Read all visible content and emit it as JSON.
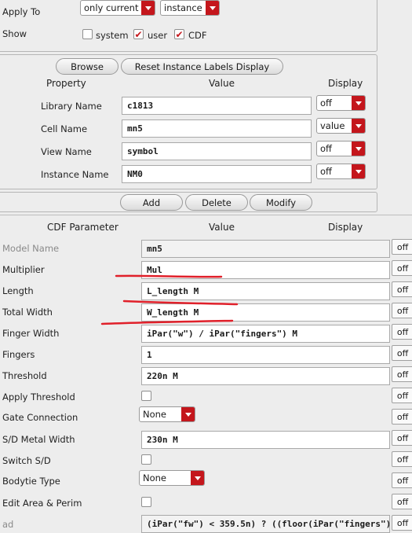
{
  "apply_to": {
    "label": "Apply To",
    "scope_value": "only current",
    "target_value": "instance"
  },
  "show": {
    "label": "Show",
    "options": [
      {
        "label": "system",
        "checked": false
      },
      {
        "label": "user",
        "checked": true
      },
      {
        "label": "CDF",
        "checked": true
      }
    ]
  },
  "instance_section": {
    "browse_label": "Browse",
    "reset_label": "Reset Instance Labels Display",
    "headers": {
      "property": "Property",
      "value": "Value",
      "display": "Display"
    },
    "rows": [
      {
        "label": "Library Name",
        "value": "c1813",
        "display": "off"
      },
      {
        "label": "Cell Name",
        "value": "mn5",
        "display": "value"
      },
      {
        "label": "View Name",
        "value": "symbol",
        "display": "off"
      },
      {
        "label": "Instance Name",
        "value": "NM0",
        "display": "off"
      }
    ]
  },
  "actions": {
    "add": "Add",
    "delete": "Delete",
    "modify": "Modify"
  },
  "cdf_section": {
    "headers": {
      "parameter": "CDF Parameter",
      "value": "Value",
      "display": "Display"
    },
    "rows": [
      {
        "label": "Model Name",
        "kind": "text",
        "value": "mn5",
        "display": "off",
        "disabled": true
      },
      {
        "label": "Multiplier",
        "kind": "text",
        "value": "Mul",
        "display": "off"
      },
      {
        "label": "Length",
        "kind": "text",
        "value": "L_length M",
        "display": "off"
      },
      {
        "label": "Total Width",
        "kind": "text",
        "value": "W_length M",
        "display": "off"
      },
      {
        "label": "Finger Width",
        "kind": "text",
        "value": "iPar(\"w\") / iPar(\"fingers\") M",
        "display": "off"
      },
      {
        "label": "Fingers",
        "kind": "text",
        "value": "1",
        "display": "off"
      },
      {
        "label": "Threshold",
        "kind": "text",
        "value": "220n M",
        "display": "off"
      },
      {
        "label": "Apply Threshold",
        "kind": "check",
        "checked": false,
        "display": "off"
      },
      {
        "label": "Gate Connection",
        "kind": "combo",
        "value": "None",
        "display": "off"
      },
      {
        "label": "S/D Metal Width",
        "kind": "text",
        "value": "230n M",
        "display": "off"
      },
      {
        "label": "Switch S/D",
        "kind": "check",
        "checked": false,
        "display": "off"
      },
      {
        "label": "Bodytie Type",
        "kind": "combo",
        "value": "None",
        "display": "off"
      },
      {
        "label": "Edit Area & Perim",
        "kind": "check",
        "checked": false,
        "display": "off"
      },
      {
        "label": "ad",
        "kind": "text",
        "value": "(iPar(\"fw\") < 359.5n) ? ((floor(iPar(\"fingers\")",
        "display": "off",
        "disabled": true
      }
    ]
  },
  "colors": {
    "accent": "#c4161c",
    "annotation": "#e0202a"
  }
}
